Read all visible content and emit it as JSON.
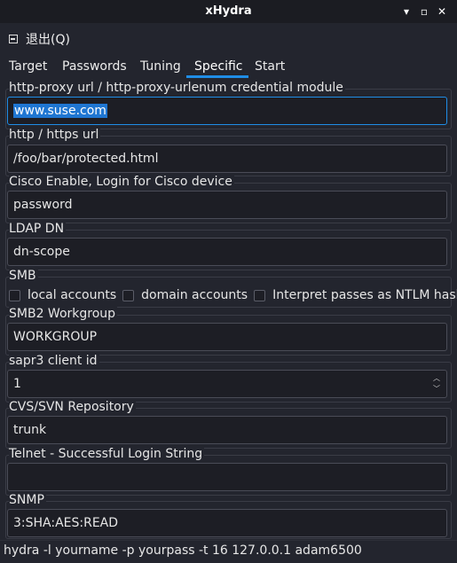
{
  "window": {
    "title": "xHydra"
  },
  "menu": {
    "quit_label": "退出(Q)"
  },
  "tabs": [
    {
      "label": "Target"
    },
    {
      "label": "Passwords"
    },
    {
      "label": "Tuning"
    },
    {
      "label": "Specific",
      "active": true
    },
    {
      "label": "Start"
    }
  ],
  "specific": {
    "http_proxy": {
      "label": "http-proxy url / http-proxy-urlenum credential module",
      "value": "www.suse.com"
    },
    "http_url": {
      "label": "http / https url",
      "value": "/foo/bar/protected.html"
    },
    "cisco": {
      "label": "Cisco Enable, Login for Cisco device",
      "value": "password"
    },
    "ldap": {
      "label": "LDAP DN",
      "value": "dn-scope"
    },
    "smb": {
      "label": "SMB",
      "options": [
        {
          "label": "local accounts",
          "checked": false
        },
        {
          "label": "domain accounts",
          "checked": false
        },
        {
          "label": "Interpret passes as NTLM hashes",
          "checked": false
        }
      ]
    },
    "smb2": {
      "label": "SMB2 Workgroup",
      "value": "WORKGROUP"
    },
    "sapr3": {
      "label": "sapr3 client id",
      "value": "1"
    },
    "cvs": {
      "label": "CVS/SVN Repository",
      "value": "trunk"
    },
    "telnet": {
      "label": "Telnet - Successful Login String",
      "value": ""
    },
    "snmp": {
      "label": "SNMP",
      "value": "3:SHA:AES:READ"
    }
  },
  "status": {
    "command": "hydra -l yourname -p yourpass -t 16 127.0.0.1 adam6500"
  },
  "colors": {
    "accent": "#1f8de6",
    "background": "#23252e",
    "field_bg": "#1d1e25"
  }
}
